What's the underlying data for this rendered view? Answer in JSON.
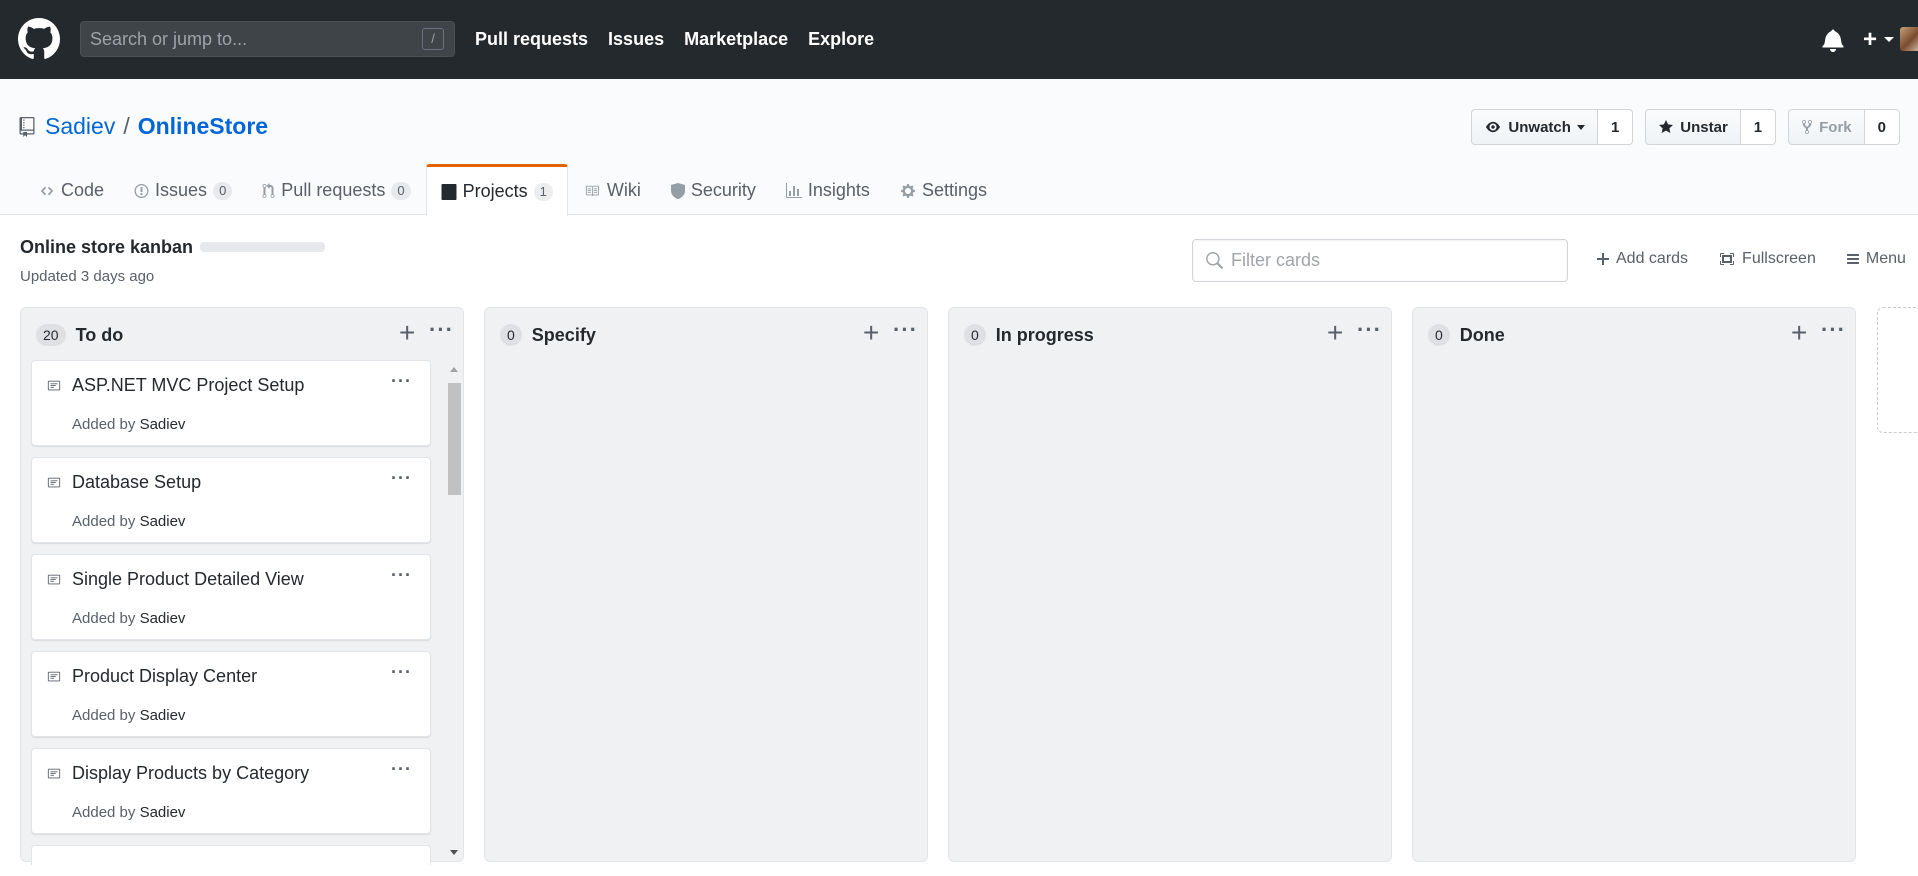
{
  "header": {
    "search_placeholder": "Search or jump to...",
    "search_shortcut": "/",
    "nav": [
      "Pull requests",
      "Issues",
      "Marketplace",
      "Explore"
    ],
    "plus_label": "+"
  },
  "repo": {
    "owner": "Sadiev",
    "separator": "/",
    "name": "OnlineStore",
    "watch": {
      "label": "Unwatch",
      "count": "1"
    },
    "star": {
      "label": "Unstar",
      "count": "1"
    },
    "fork": {
      "label": "Fork",
      "count": "0"
    }
  },
  "tabs": [
    {
      "label": "Code"
    },
    {
      "label": "Issues",
      "count": "0"
    },
    {
      "label": "Pull requests",
      "count": "0"
    },
    {
      "label": "Projects",
      "count": "1"
    },
    {
      "label": "Wiki"
    },
    {
      "label": "Security"
    },
    {
      "label": "Insights"
    },
    {
      "label": "Settings"
    }
  ],
  "project": {
    "name": "Online store kanban",
    "updated": "Updated 3 days ago",
    "filter_placeholder": "Filter cards",
    "actions": {
      "add_cards": "Add cards",
      "fullscreen": "Fullscreen",
      "menu": "Menu"
    }
  },
  "columns": [
    {
      "count": "20",
      "name": "To do",
      "cards": [
        {
          "title": "ASP.NET MVC Project Setup",
          "added_prefix": "Added by",
          "author": "Sadiev"
        },
        {
          "title": "Database Setup",
          "added_prefix": "Added by",
          "author": "Sadiev"
        },
        {
          "title": "Single Product Detailed View",
          "added_prefix": "Added by",
          "author": "Sadiev"
        },
        {
          "title": "Product Display Center",
          "added_prefix": "Added by",
          "author": "Sadiev"
        },
        {
          "title": "Display Products by Category",
          "added_prefix": "Added by",
          "author": "Sadiev"
        }
      ]
    },
    {
      "count": "0",
      "name": "Specify",
      "cards": []
    },
    {
      "count": "0",
      "name": "In progress",
      "cards": []
    },
    {
      "count": "0",
      "name": "Done",
      "cards": []
    }
  ],
  "colors": {
    "header_bg": "#24292e",
    "link": "#0366d6",
    "selected_tab_accent": "#e36209",
    "column_bg": "#eff1f3"
  }
}
